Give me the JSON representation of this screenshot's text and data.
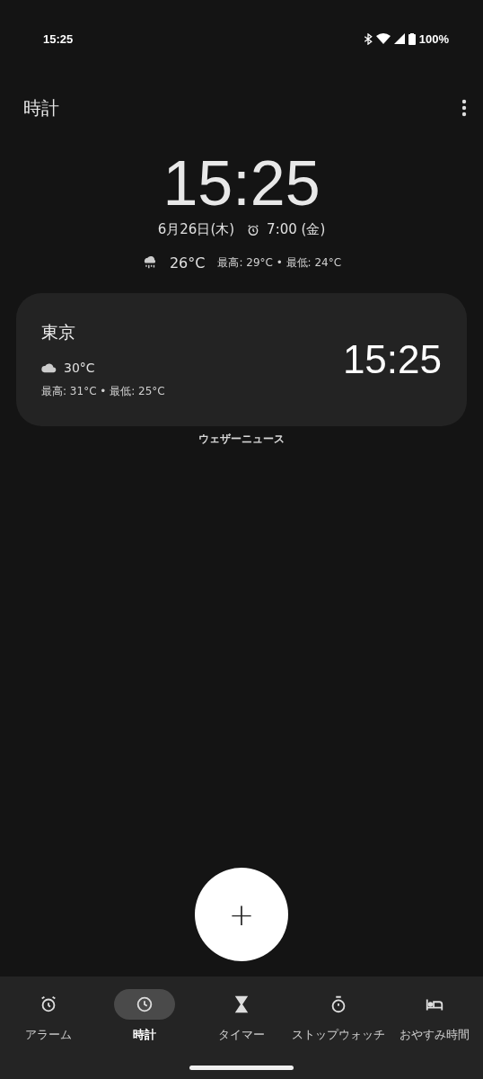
{
  "status_bar": {
    "time": "15:25",
    "battery": "100%"
  },
  "app_bar": {
    "title": "時計"
  },
  "clock": {
    "time": "15:25",
    "date": "6月26日(木)",
    "alarm": "7:00 (金)",
    "temperature": "26°C",
    "high_low": "最高: 29°C • 最低: 24°C"
  },
  "cities": [
    {
      "name": "東京",
      "temperature": "30°C",
      "high_low": "最高: 31°C • 最低: 25°C",
      "time": "15:25"
    }
  ],
  "weather_link": "ウェザーニュース",
  "fab": {
    "label": "+"
  },
  "tabs": [
    {
      "kind": "alarm",
      "label": "アラーム",
      "selected": false
    },
    {
      "kind": "clock",
      "label": "時計",
      "selected": true
    },
    {
      "kind": "timer",
      "label": "タイマー",
      "selected": false
    },
    {
      "kind": "stopwatch",
      "label": "ストップウォッチ",
      "selected": false
    },
    {
      "kind": "bedtime",
      "label": "おやすみ時間",
      "selected": false
    }
  ]
}
